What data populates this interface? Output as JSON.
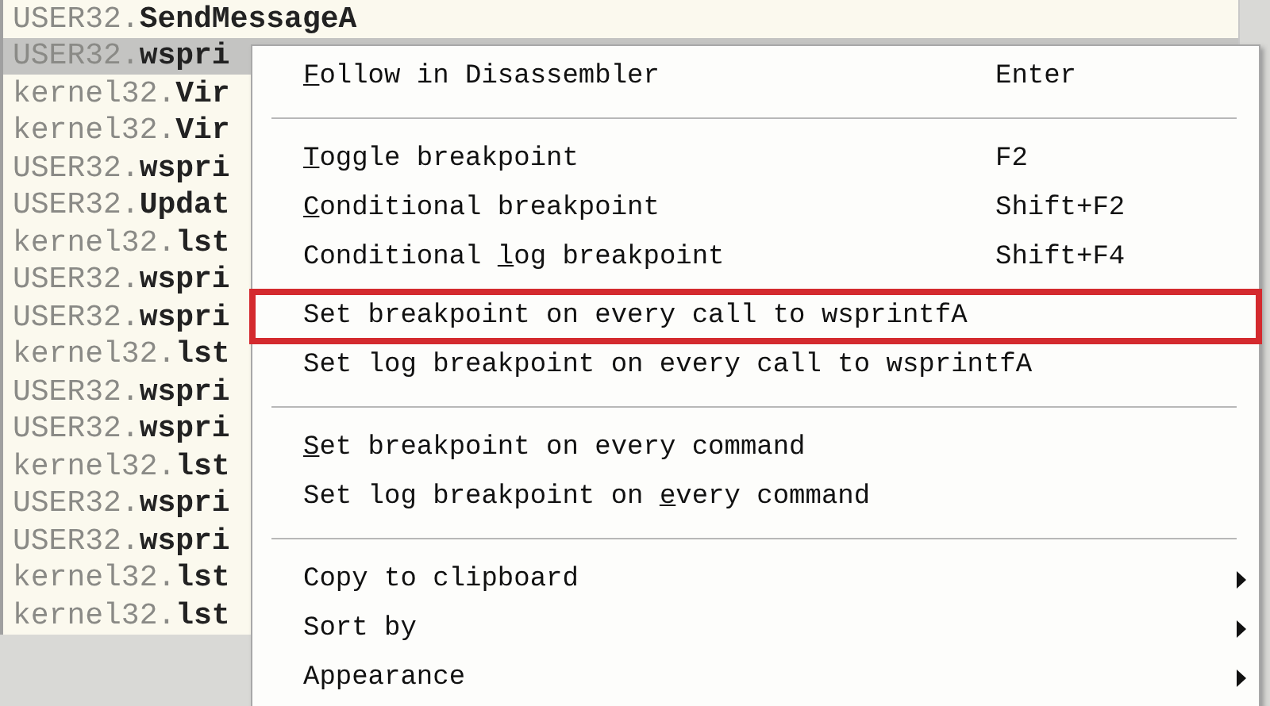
{
  "list": {
    "rows": [
      {
        "module": "USER32.",
        "func": "SendMessageA",
        "selected": false
      },
      {
        "module": "USER32.",
        "func": "wspri",
        "selected": true
      },
      {
        "module": "kernel32.",
        "func": "Vir",
        "selected": false
      },
      {
        "module": "kernel32.",
        "func": "Vir",
        "selected": false
      },
      {
        "module": "USER32.",
        "func": "wspri",
        "selected": false
      },
      {
        "module": "USER32.",
        "func": "Updat",
        "selected": false
      },
      {
        "module": "kernel32.",
        "func": "lst",
        "selected": false
      },
      {
        "module": "USER32.",
        "func": "wspri",
        "selected": false
      },
      {
        "module": "USER32.",
        "func": "wspri",
        "selected": false
      },
      {
        "module": "kernel32.",
        "func": "lst",
        "selected": false
      },
      {
        "module": "USER32.",
        "func": "wspri",
        "selected": false
      },
      {
        "module": "USER32.",
        "func": "wspri",
        "selected": false
      },
      {
        "module": "kernel32.",
        "func": "lst",
        "selected": false
      },
      {
        "module": "USER32.",
        "func": "wspri",
        "selected": false
      },
      {
        "module": "USER32.",
        "func": "wspri",
        "selected": false
      },
      {
        "module": "kernel32.",
        "func": "lst",
        "selected": false
      },
      {
        "module": "kernel32.",
        "func": "lst",
        "selected": false
      }
    ]
  },
  "context_menu": {
    "items": [
      {
        "kind": "item",
        "mnemonic": "F",
        "after": "ollow in Disassembler",
        "shortcut": "Enter",
        "highlighted": false,
        "submenu": false
      },
      {
        "kind": "separator"
      },
      {
        "kind": "item",
        "mnemonic": "T",
        "after": "oggle breakpoint",
        "shortcut": "F2",
        "highlighted": false,
        "submenu": false
      },
      {
        "kind": "item",
        "mnemonic": "C",
        "after": "onditional breakpoint",
        "shortcut": "Shift+F2",
        "highlighted": false,
        "submenu": false
      },
      {
        "kind": "item",
        "before": "Conditional ",
        "mnemonic": "l",
        "after": "og breakpoint",
        "shortcut": "Shift+F4",
        "highlighted": false,
        "submenu": false
      },
      {
        "kind": "item",
        "before": "Set breakpoint on every call to wsprintfA",
        "highlighted": true,
        "submenu": false
      },
      {
        "kind": "item",
        "before": "Set log breakpoint on every call to wsprintfA",
        "highlighted": false,
        "submenu": false
      },
      {
        "kind": "separator"
      },
      {
        "kind": "item",
        "mnemonic": "S",
        "after": "et breakpoint on every command",
        "highlighted": false,
        "submenu": false
      },
      {
        "kind": "item",
        "before": "Set log breakpoint on ",
        "mnemonic": "e",
        "after": "very command",
        "highlighted": false,
        "submenu": false
      },
      {
        "kind": "separator"
      },
      {
        "kind": "item",
        "before": "Copy to clipboard",
        "highlighted": false,
        "submenu": true
      },
      {
        "kind": "item",
        "before": "Sort by",
        "highlighted": false,
        "submenu": true
      },
      {
        "kind": "item",
        "before": "Appearance",
        "highlighted": false,
        "submenu": true
      }
    ]
  }
}
